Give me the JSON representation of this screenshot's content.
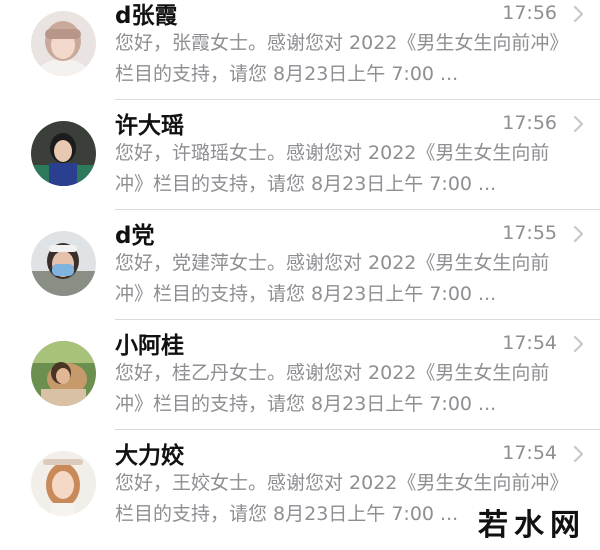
{
  "conversations": [
    {
      "name": "d张霞",
      "time": "17:56",
      "preview": "您好，张霞女士。感谢您对 2022《男生女生向前冲》栏目的支持，请您 8月23日上午 7:00 ...",
      "avatar_icon": "avatar-photo-girl"
    },
    {
      "name": "许大瑶",
      "time": "17:56",
      "preview": "您好，许璐瑶女士。感谢您对 2022《男生女生向前冲》栏目的支持，请您 8月23日上午 7:00 ...",
      "avatar_icon": "avatar-photo-student"
    },
    {
      "name": "d党",
      "time": "17:55",
      "preview": "您好，党建萍女士。感谢您对 2022《男生女生向前冲》栏目的支持，请您 8月23日上午 7:00 ...",
      "avatar_icon": "avatar-photo-mask"
    },
    {
      "name": "小阿桂",
      "time": "17:54",
      "preview": "您好，桂乙丹女士。感谢您对 2022《男生女生向前冲》栏目的支持，请您 8月23日上午 7:00 ...",
      "avatar_icon": "avatar-photo-outdoor"
    },
    {
      "name": "大力姣",
      "time": "17:54",
      "preview": "您好，王姣女士。感谢您对 2022《男生女生向前冲》栏目的支持，请您 8月23日上午 7:00 ...",
      "avatar_icon": "avatar-photo-portrait"
    }
  ],
  "watermark": {
    "text": "若水网"
  },
  "colors": {
    "name": "#111111",
    "secondary": "#8e8e93",
    "separator": "#d9d9de",
    "chevron": "#c7c7cc"
  }
}
